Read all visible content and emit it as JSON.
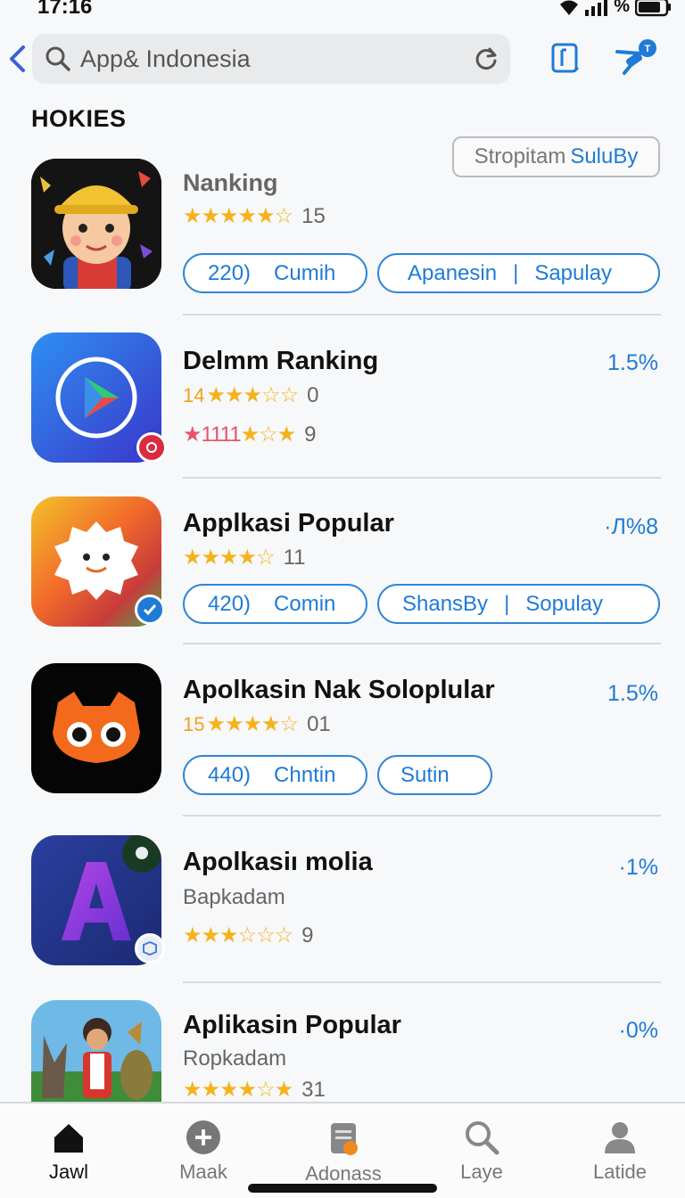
{
  "status_bar": {
    "time": "17:16",
    "battery_label": "%"
  },
  "search": {
    "placeholder": "App& Indonesia"
  },
  "section": {
    "title": "HOKIES"
  },
  "filter_chip": {
    "part1": "Stropitam",
    "part2": "SuluBy"
  },
  "apps": [
    {
      "name": "Nanking",
      "rating_prefix": "",
      "stars": "★★★★★☆",
      "count": "15",
      "pills": [
        {
          "left": "220)",
          "right": "Cumih"
        },
        {
          "left": "Apanesin",
          "right": "Sapulay"
        }
      ],
      "icon": "cartoon-boy-hardhat-icon"
    },
    {
      "name": "Delmm Ranking",
      "percent": "1.5%",
      "rating_prefix": "14",
      "stars": "★★★☆☆",
      "count": "0",
      "rating2_prefix": "★1111",
      "stars2": "★☆★",
      "count2": "9",
      "icon": "play-circle-icon"
    },
    {
      "name": "Applkasi Popular",
      "percent": "·Л%8",
      "rating_prefix": "",
      "stars": "★★★★☆",
      "count": "11",
      "pills": [
        {
          "left": "420)",
          "right": "Comin"
        },
        {
          "left": "ShansBy",
          "right": "Sopulay"
        }
      ],
      "icon": "fluffy-creature-icon"
    },
    {
      "name": "Apolkasin Nak Soloplular",
      "percent": "1.5%",
      "rating_prefix": "15",
      "stars": "★★★★☆",
      "count": "01",
      "pills": [
        {
          "left": "440)",
          "right": "Chntin"
        },
        {
          "left": "Sutin",
          "right": ""
        }
      ],
      "icon": "orange-mask-icon"
    },
    {
      "name": "Apolkasiı molia",
      "percent": "·1%",
      "sub": "Bapkadam",
      "rating_prefix": "",
      "stars": "★★★☆☆☆",
      "count": "9",
      "icon": "letter-a-icon"
    },
    {
      "name": "Aplikasin Popular",
      "percent": "·0%",
      "sub": "Ropkadam",
      "rating_prefix": "",
      "stars": "★★★★☆★",
      "count": "31",
      "icon": "characters-scene-icon"
    }
  ],
  "tabs": [
    {
      "label": "Jawl",
      "icon": "home-icon"
    },
    {
      "label": "Maak",
      "icon": "plus-circle-icon"
    },
    {
      "label": "Adonass",
      "icon": "document-badge-icon"
    },
    {
      "label": "Laye",
      "icon": "search-icon"
    },
    {
      "label": "Latide",
      "icon": "profile-icon"
    }
  ],
  "colors": {
    "accent": "#1f7bd6",
    "star": "#f5b21c",
    "pink_star": "#e8536b"
  }
}
